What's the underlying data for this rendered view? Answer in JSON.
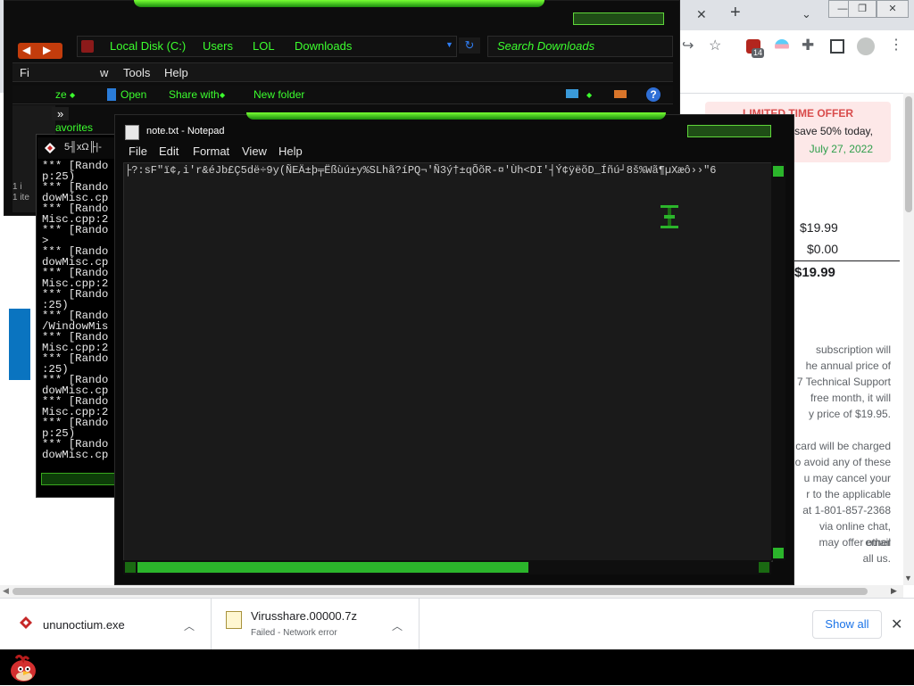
{
  "browser": {
    "window_controls": {
      "minimize": "—",
      "restore": "❐",
      "close": "✕"
    },
    "tab_controls": {
      "close": "✕",
      "new": "+",
      "chevron": "⌄"
    },
    "extension_badge": "14",
    "offer": {
      "title": "LIMITED TIME OFFER",
      "line1": "save 50% today,",
      "line2": "July 27, 2022"
    },
    "prices": [
      "$19.99",
      "$0.00",
      "$19.99"
    ],
    "legal_lines": [
      "subscription will",
      "he annual price of",
      "7 Technical Support",
      "free month, it will",
      "y price of $19.95.",
      "",
      "card will be charged",
      "o avoid any of these",
      "u may cancel your",
      "r to the applicable",
      "at 1-801-857-2368",
      "via online chat, email",
      "may offer other",
      "all us."
    ]
  },
  "downloads": {
    "items": [
      {
        "name": "ununoctium.exe",
        "status": ""
      },
      {
        "name": "Virusshare.00000.7z",
        "status": "Failed - Network error"
      }
    ],
    "show_all": "Show all"
  },
  "explorer": {
    "breadcrumbs": [
      "Local Disk (C:)",
      "Users",
      "LOL",
      "Downloads"
    ],
    "search_placeholder": "Search Downloads",
    "menu": [
      "Fi",
      "w",
      "Tools",
      "Help"
    ],
    "commands": [
      "ze",
      "Open",
      "Share with",
      "New folder"
    ],
    "overflow": "»",
    "favorites": "avorites",
    "status_left": "1 i",
    "status_left2": "1 ite"
  },
  "console": {
    "title": "5╢xΩ╟|-",
    "lines": [
      "*** [Rando",
      "p:25)",
      "*** [Rando",
      "dowMisc.cp",
      "*** [Rando",
      "Misc.cpp:2",
      "*** [Rando",
      ">",
      "*** [Rando",
      "dowMisc.cp",
      "*** [Rando",
      "Misc.cpp:2",
      "*** [Rando",
      ":25)",
      "*** [Rando",
      "/WindowMis",
      "*** [Rando",
      "Misc.cpp:2",
      "*** [Rando",
      ":25)",
      "*** [Rando",
      "dowMisc.cp",
      "*** [Rando",
      "Misc.cpp:2",
      "*** [Rando",
      "p:25)",
      "*** [Rando",
      "dowMisc.cp"
    ]
  },
  "notepad": {
    "title": "note.txt - Notepad",
    "menu": [
      "File",
      "Edit",
      "Format",
      "View",
      "Help"
    ],
    "content": "├?:sF\"ï¢,i'r&éJb£Ç5dë÷9y(ÑEÄ±þ╤Ëßùú±y%SLhã?íPQ¬'Ñ3ý†±qÕõR-¤'Ùh<DI'┤Ý¢ÿëõD_Íñú┘8š%Wã¶µXæô››\"6"
  },
  "colors": {
    "theme_green": "#3cff2e",
    "window_dark": "#0b0b0b",
    "offer_red": "#d94c4c",
    "offer_green": "#2e9e4a",
    "link_blue": "#1a73e8"
  }
}
